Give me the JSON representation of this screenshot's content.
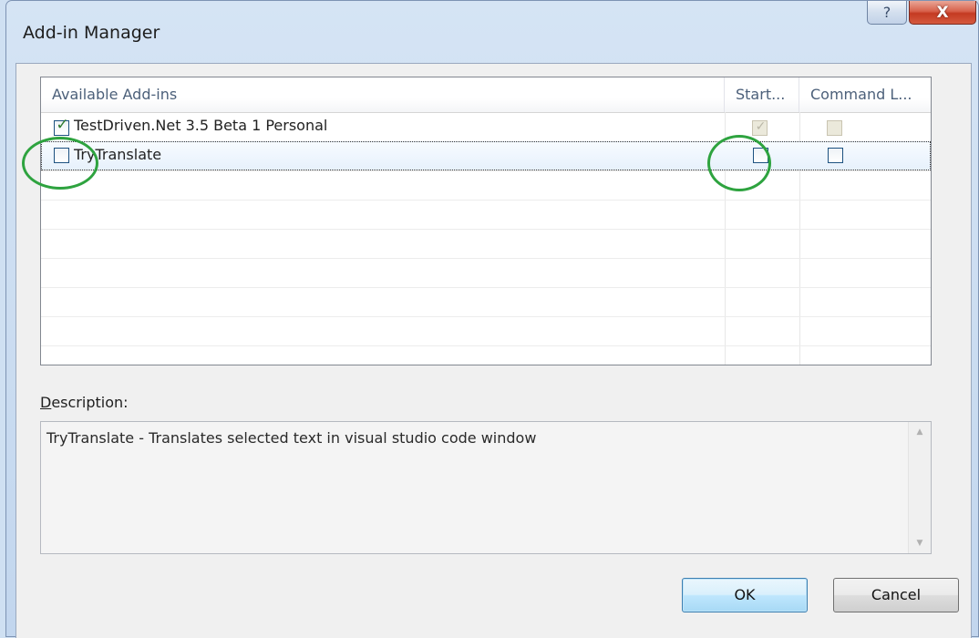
{
  "window": {
    "title": "Add-in Manager",
    "help_glyph": "?",
    "close_glyph": "X"
  },
  "list": {
    "columns": [
      "Available Add-ins",
      "Start...",
      "Command L..."
    ],
    "rows": [
      {
        "label": "TestDriven.Net 3.5 Beta 1 Personal",
        "enabled": true,
        "startup": true,
        "command_line": false,
        "selected": false
      },
      {
        "label": "TryTranslate",
        "enabled": false,
        "startup": false,
        "command_line": false,
        "selected": true
      }
    ]
  },
  "description": {
    "label_prefix": "D",
    "label_rest": "escription:",
    "text": "TryTranslate - Translates selected text in visual studio code window",
    "scroll_up_glyph": "▲",
    "scroll_down_glyph": "▼"
  },
  "buttons": {
    "ok": "OK",
    "cancel": "Cancel"
  },
  "check_glyph": "✓",
  "colors": {
    "annotation_circle": "#2ea33f",
    "close_button": "#c43a22",
    "default_button_border": "#3c7fb1"
  }
}
